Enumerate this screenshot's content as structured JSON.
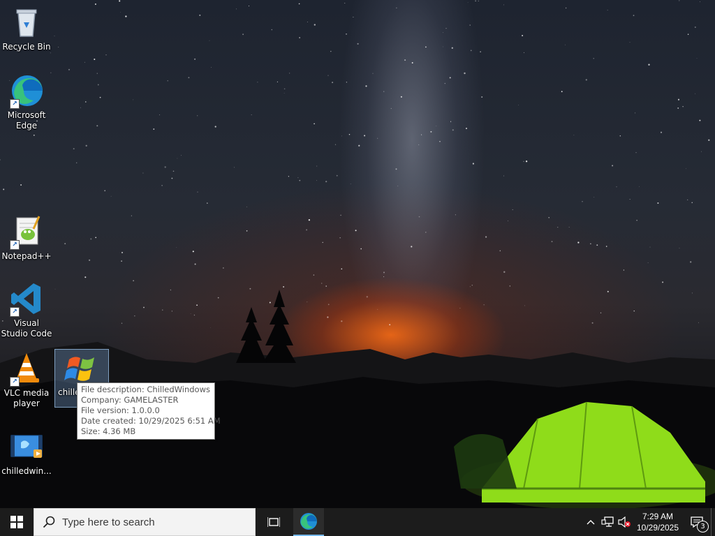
{
  "desktop": {
    "icons": [
      {
        "label": "Recycle Bin"
      },
      {
        "label": "Microsoft Edge"
      },
      {
        "label": "Notepad++"
      },
      {
        "label": "Visual Studio Code"
      },
      {
        "label": "VLC media player"
      },
      {
        "label": "chilledwin..."
      },
      {
        "label": "chille"
      }
    ]
  },
  "tooltip": {
    "description": "File description: ChilledWindows",
    "company": "Company: GAMELASTER",
    "version": "File version: 1.0.0.0",
    "date_created": "Date created: 10/29/2025 6:51 AM",
    "size": "Size: 4.36 MB"
  },
  "taskbar": {
    "search": {
      "placeholder": "Type here to search"
    },
    "clock": {
      "time": "7:29 AM",
      "date": "10/29/2025"
    },
    "notifications": {
      "count": "3"
    }
  },
  "colors": {
    "taskbar_bg": "#1c1c1c",
    "accent": "#76b9ed"
  },
  "icons": [
    "windows-start-icon",
    "search-icon",
    "task-view-icon",
    "edge-icon",
    "chevron-up-icon",
    "network-icon",
    "volume-muted-icon",
    "notification-icon"
  ]
}
